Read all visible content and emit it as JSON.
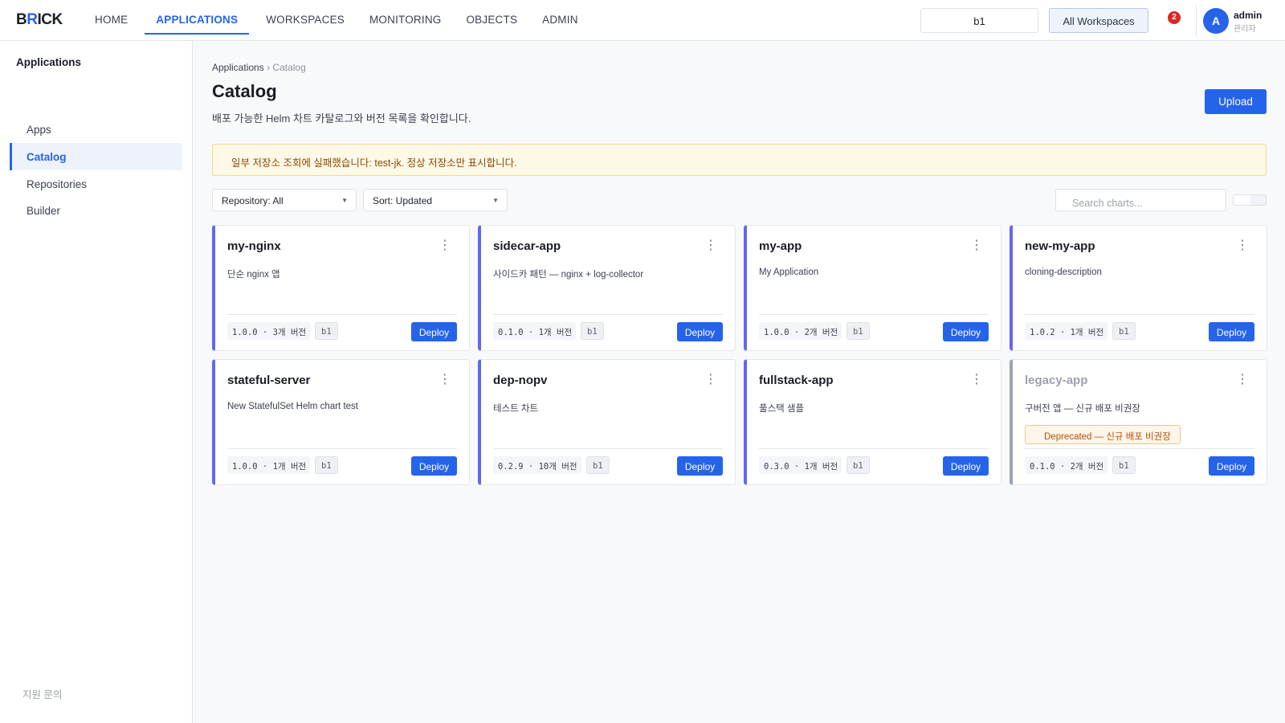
{
  "header": {
    "logo_prefix": "B",
    "logo_accent": "R",
    "logo_suffix": "ICK",
    "nav": [
      "HOME",
      "APPLICATIONS",
      "WORKSPACES",
      "MONITORING",
      "OBJECTS",
      "ADMIN"
    ],
    "active_nav": "APPLICATIONS",
    "workspace_value": "b1",
    "workspace_button": "All Workspaces",
    "notification_count": "2",
    "user_initial": "A",
    "user_name": "admin",
    "user_role": "관리자"
  },
  "sidebar": {
    "title": "Applications",
    "items": [
      "Apps",
      "Catalog",
      "Repositories",
      "Builder"
    ],
    "active": "Catalog",
    "footer": "지원 문의"
  },
  "main": {
    "breadcrumb": {
      "parent": "Applications",
      "separator": "›",
      "current": "Catalog"
    },
    "title": "Catalog",
    "description": "배포 가능한 Helm 차트 카탈로그와 버전 목록을 확인합니다.",
    "upload_label": "Upload",
    "warning": "일부 저장소 조회에 실패했습니다: test-jk. 정상 저장소만 표시합니다.",
    "repository_filter": "Repository: All",
    "sort_filter": "Sort: Updated",
    "search_placeholder": "Search charts...",
    "deploy_label": "Deploy"
  },
  "cards": [
    {
      "name": "my-nginx",
      "description": "단순 nginx 앱",
      "version": "1.0.0 · 3개 버전",
      "workspace": "b1",
      "deprecated": false,
      "badge": ""
    },
    {
      "name": "sidecar-app",
      "description": "사이드카 패턴 — nginx + log-collector",
      "version": "0.1.0 · 1개 버전",
      "workspace": "b1",
      "deprecated": false,
      "badge": ""
    },
    {
      "name": "my-app",
      "description": "My Application",
      "version": "1.0.0 · 2개 버전",
      "workspace": "b1",
      "deprecated": false,
      "badge": ""
    },
    {
      "name": "new-my-app",
      "description": "cloning-description",
      "version": "1.0.2 · 1개 버전",
      "workspace": "b1",
      "deprecated": false,
      "badge": ""
    },
    {
      "name": "stateful-server",
      "description": "New StatefulSet Helm chart test",
      "version": "1.0.0 · 1개 버전",
      "workspace": "b1",
      "deprecated": false,
      "badge": ""
    },
    {
      "name": "dep-nopv",
      "description": "테스트 차트",
      "version": "0.2.9 · 10개 버전",
      "workspace": "b1",
      "deprecated": false,
      "badge": ""
    },
    {
      "name": "fullstack-app",
      "description": "풀스택 샘플",
      "version": "0.3.0 · 1개 버전",
      "workspace": "b1",
      "deprecated": false,
      "badge": ""
    },
    {
      "name": "legacy-app",
      "description": "구버전 앱 — 신규 배포 비권장",
      "version": "0.1.0 · 2개 버전",
      "workspace": "b1",
      "deprecated": true,
      "badge": "Deprecated — 신규 배포 비권장"
    }
  ],
  "colors": {
    "accent": "#2563eb",
    "card_accent": "#6366f1",
    "deprecated_accent": "#9aa4b4",
    "notification": "#dc2626",
    "warning_bg": "#fef9e7"
  }
}
